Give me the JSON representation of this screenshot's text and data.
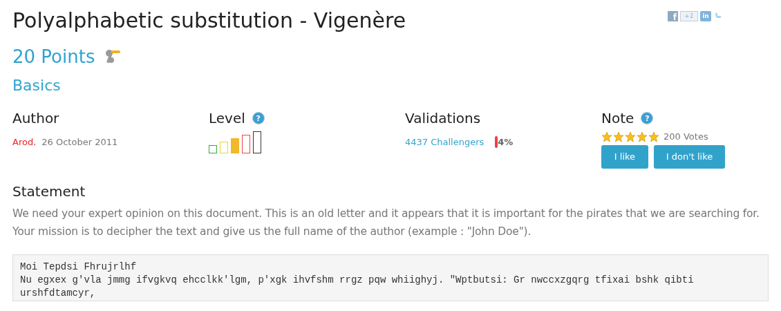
{
  "title": "Polyalphabetic substitution - Vigenère",
  "share": [
    {
      "kind": "facebook",
      "label": "f"
    },
    {
      "kind": "plusone",
      "label": "+1"
    },
    {
      "kind": "linkedin",
      "label": "in"
    },
    {
      "kind": "twitter"
    }
  ],
  "help_icon": "?",
  "points": "20 Points",
  "category": "Basics",
  "author": {
    "heading": "Author",
    "name": "Arod",
    "separator": ",",
    "date": "26 October 2011"
  },
  "level": {
    "heading": "Level",
    "bars": [
      {
        "color": "#3aa53a",
        "selected": false
      },
      {
        "color": "#e8d440",
        "selected": false
      },
      {
        "color": "#f0b92a",
        "selected": true
      },
      {
        "color": "#e84444",
        "selected": false
      },
      {
        "color": "#333333",
        "selected": false
      }
    ]
  },
  "validations": {
    "heading": "Validations",
    "challengers": "4437 Challengers",
    "percent": "4%"
  },
  "note": {
    "heading": "Note",
    "stars": 5,
    "votes": "200 Votes",
    "buttons": [
      "I like",
      "I don't like"
    ]
  },
  "statement": {
    "heading": "Statement",
    "text": "We need your expert opinion on this document. This is an old letter and it appears that it is important for the pirates that we are searching for. Your mission is to decipher the text and give us the full name of the author (example : \"John Doe\").",
    "code": [
      "Moi Tepdsi Fhrujrlhf",
      "Nu egxex g'vla jmmg ifvgkvq ehcclkk'lgm, p'xgk ihvfshm rrgz pqw whiighyj. \"Wptbutsi: Gr nwccxzgqrg tfixai bshk qibti urshfdtamcyr,"
    ]
  }
}
